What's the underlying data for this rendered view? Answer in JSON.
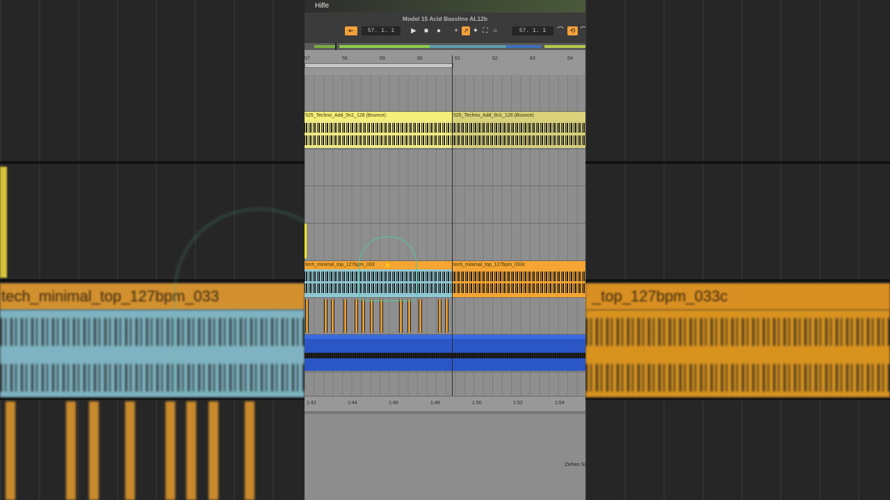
{
  "menubar": {
    "help_label": "Hilfe"
  },
  "window": {
    "title": "Model 15 Acid Bassline AL12b"
  },
  "transport": {
    "arrangement_position": "57. 1. 1",
    "loop_position": "57. 1. 1"
  },
  "ruler": {
    "bars": [
      "57",
      "58",
      "59",
      "60",
      "61",
      "62",
      "63",
      "64"
    ]
  },
  "clips": {
    "yellow_left": "525_Techno_Add_0n1_128 (Bounce)",
    "yellow_right": "525_Techno_Add_0n1_128 (Bounce)",
    "orange_left": "tech_minimal_top_127bpm_033",
    "orange_right": "tech_minimal_top_127bpm_033c"
  },
  "timeline": {
    "labels": [
      "1:42",
      "1:44",
      "1:46",
      "1:48",
      "1:50",
      "1:52",
      "1:54"
    ]
  },
  "status": {
    "hint": "Ziehen Si"
  },
  "background": {
    "left_clip_title": "tech_minimal_top_127bpm_033",
    "right_clip_title": "_top_127bpm_033c"
  },
  "colors": {
    "accent_orange": "#f2a13a",
    "clip_yellow": "#e9e57a",
    "clip_orange": "#f5a533",
    "clip_selected_blue": "#8fc7d2",
    "clip_blue": "#2a56c6"
  }
}
